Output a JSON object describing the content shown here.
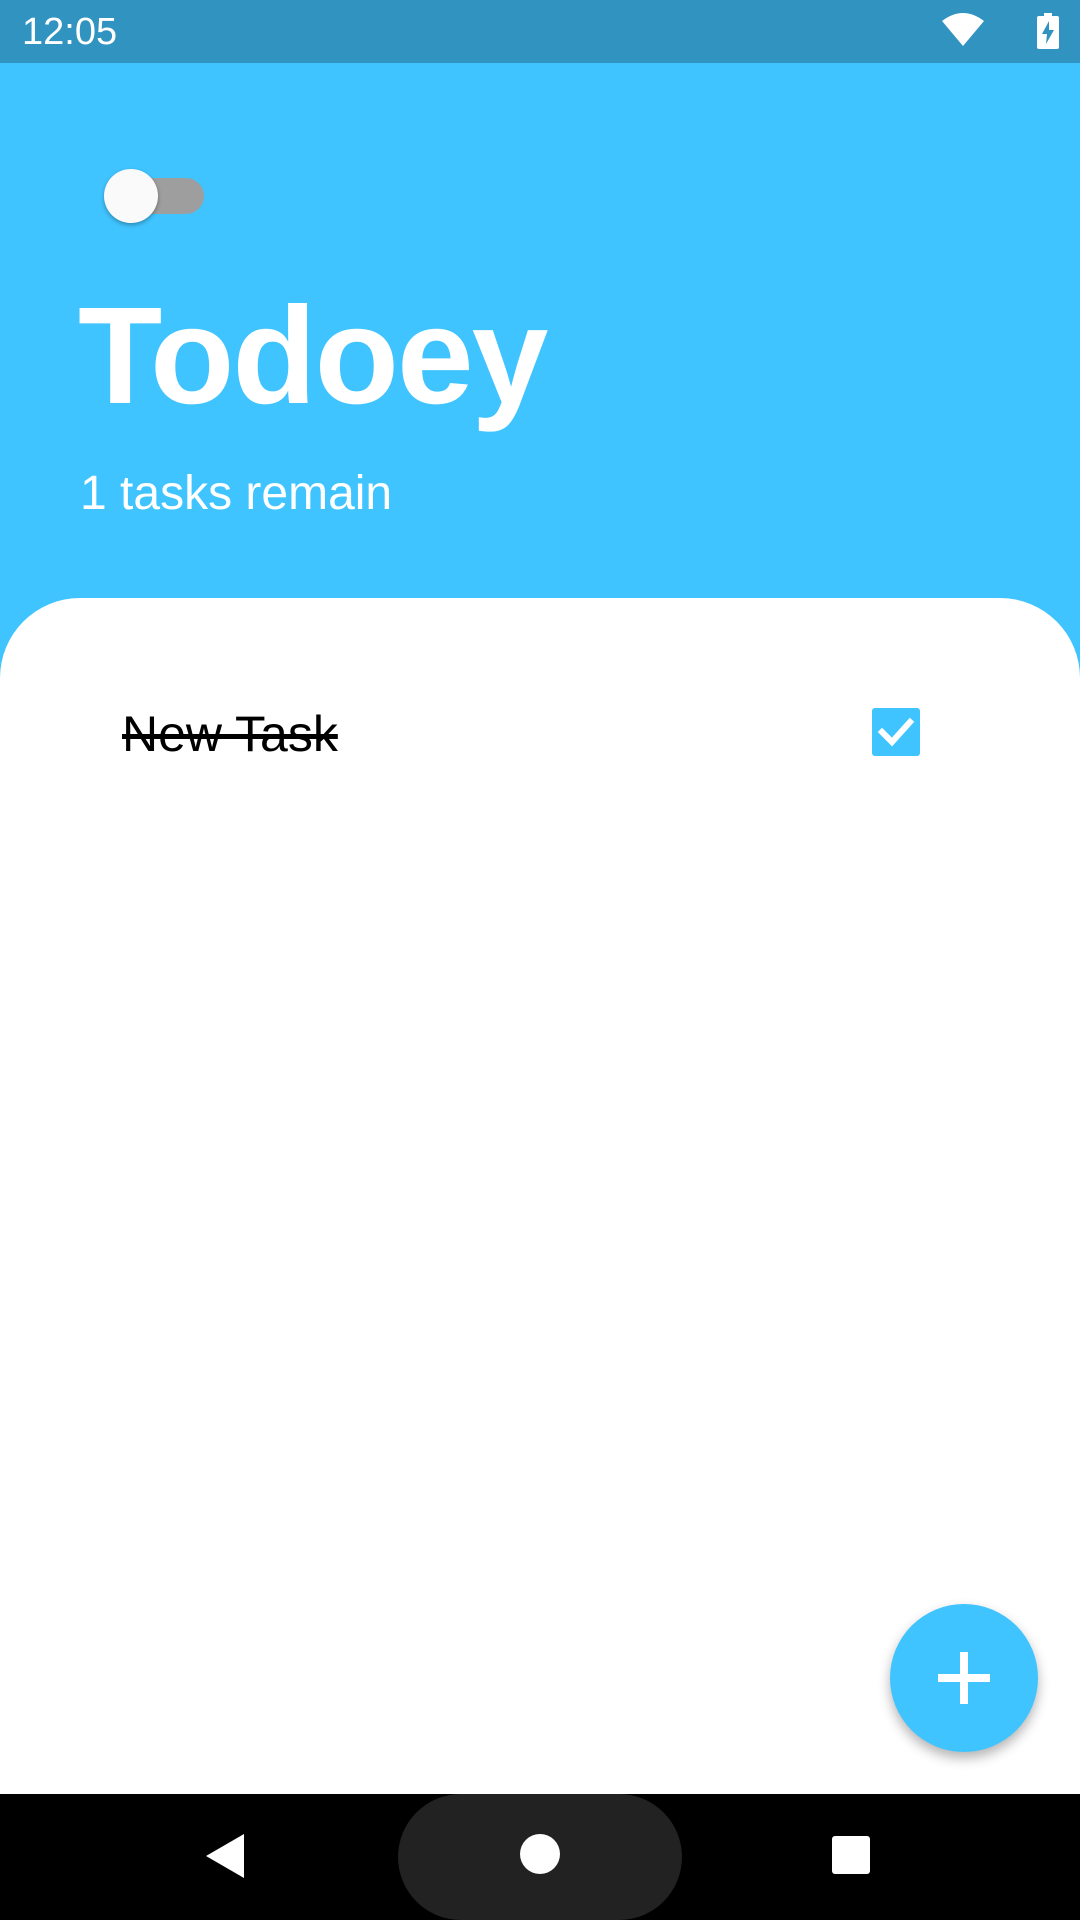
{
  "status_bar": {
    "time": "12:05",
    "wifi_icon": "wifi-icon",
    "battery_icon": "battery-charging-icon"
  },
  "header": {
    "theme_toggle": {
      "state": "off"
    },
    "title": "Todoey",
    "subtitle": "1 tasks remain"
  },
  "tasks": [
    {
      "title": "New Task",
      "done": true
    }
  ],
  "fab": {
    "icon": "plus-icon"
  },
  "nav_bar": {
    "back_icon": "back-icon",
    "home_icon": "home-icon",
    "recents_icon": "recents-icon"
  },
  "colors": {
    "accent": "#40C4FF",
    "status_bar": "#3093C0",
    "switch_track_off": "#9E9E9E"
  }
}
